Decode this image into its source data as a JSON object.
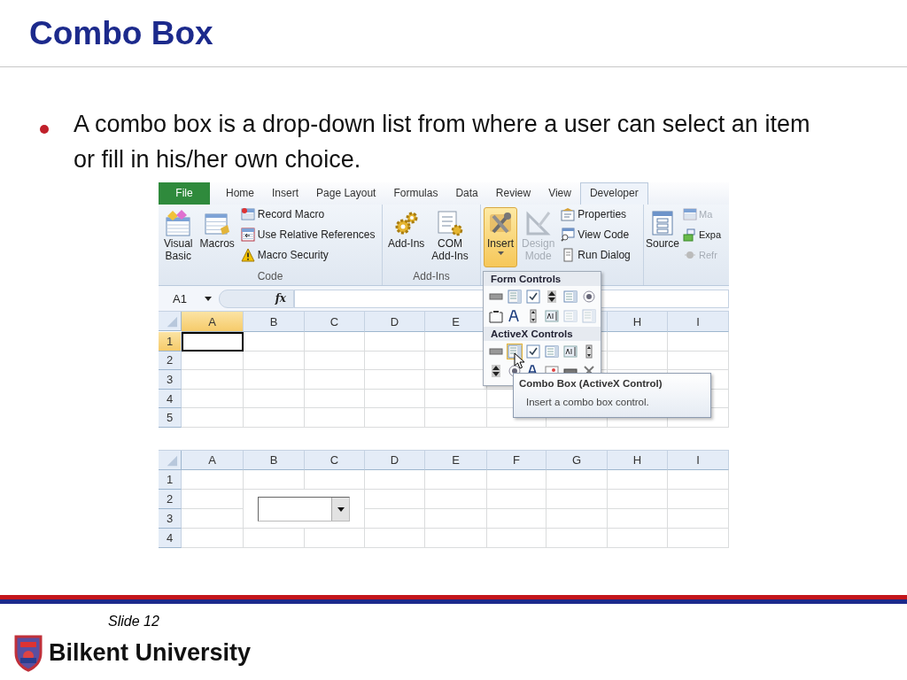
{
  "slide": {
    "title": "Combo Box",
    "bullets": [
      "A combo box is a drop-down list from where a user can select an item or fill in his/her own choice."
    ]
  },
  "ribbon": {
    "tabs": [
      {
        "label": "File",
        "kind": "file",
        "selected": false
      },
      {
        "label": "Home",
        "kind": "tab",
        "selected": false
      },
      {
        "label": "Insert",
        "kind": "tab",
        "selected": false
      },
      {
        "label": "Page Layout",
        "kind": "tab",
        "selected": false
      },
      {
        "label": "Formulas",
        "kind": "tab",
        "selected": false
      },
      {
        "label": "Data",
        "kind": "tab",
        "selected": false
      },
      {
        "label": "Review",
        "kind": "tab",
        "selected": false
      },
      {
        "label": "View",
        "kind": "tab",
        "selected": false
      },
      {
        "label": "Developer",
        "kind": "tab",
        "selected": true
      }
    ],
    "groups": [
      {
        "label": "Code",
        "large": [
          {
            "label": "Visual\nBasic",
            "selected": false,
            "disabled": false
          },
          {
            "label": "Macros",
            "selected": false,
            "disabled": false
          }
        ],
        "small": [
          {
            "label": "Record Macro",
            "disabled": false
          },
          {
            "label": "Use Relative References",
            "disabled": false
          },
          {
            "label": "Macro Security",
            "disabled": false
          }
        ]
      },
      {
        "label": "Add-Ins",
        "large": [
          {
            "label": "Add-Ins",
            "selected": false,
            "disabled": false
          },
          {
            "label": "COM\nAdd-Ins",
            "selected": false,
            "disabled": false
          }
        ]
      },
      {
        "large": [
          {
            "label": "Insert",
            "selected": true,
            "disabled": false,
            "dropdown": true
          },
          {
            "label": "Design\nMode",
            "selected": false,
            "disabled": true
          }
        ],
        "small": [
          {
            "label": "Properties",
            "disabled": false
          },
          {
            "label": "View Code",
            "disabled": false
          },
          {
            "label": "Run Dialog",
            "disabled": false
          }
        ]
      },
      {
        "large": [
          {
            "label": "Source",
            "selected": false,
            "disabled": false
          }
        ],
        "small": [
          {
            "label": "Ma",
            "disabled": true
          },
          {
            "label": "Expa",
            "disabled": false
          },
          {
            "label": "Refr",
            "disabled": true
          }
        ]
      }
    ]
  },
  "formula_bar": {
    "name_box": "A1",
    "function_label": "fx"
  },
  "sheets": [
    {
      "columns": [
        {
          "label": "A",
          "selected": true
        },
        {
          "label": "B",
          "selected": false
        },
        {
          "label": "C",
          "selected": false
        },
        {
          "label": "D",
          "selected": false
        },
        {
          "label": "E",
          "selected": false
        },
        {
          "label": "H",
          "selected": false
        },
        {
          "label": "I",
          "selected": false
        }
      ],
      "rows": [
        {
          "label": "1",
          "selected": true
        },
        {
          "label": "2",
          "selected": false
        },
        {
          "label": "3",
          "selected": false
        },
        {
          "label": "4",
          "selected": false
        },
        {
          "label": "5",
          "selected": false
        }
      ]
    },
    {
      "columns": [
        {
          "label": "A",
          "selected": false
        },
        {
          "label": "B",
          "selected": false
        },
        {
          "label": "C",
          "selected": false
        },
        {
          "label": "D",
          "selected": false
        },
        {
          "label": "E",
          "selected": false
        },
        {
          "label": "F",
          "selected": false
        },
        {
          "label": "G",
          "selected": false
        },
        {
          "label": "H",
          "selected": false
        },
        {
          "label": "I",
          "selected": false
        }
      ],
      "rows": [
        {
          "label": "1",
          "selected": false
        },
        {
          "label": "2",
          "selected": false
        },
        {
          "label": "3",
          "selected": false
        },
        {
          "label": "4",
          "selected": false
        }
      ],
      "controls": [
        {
          "kind": "combo_box"
        }
      ]
    }
  ],
  "gallery": {
    "sections": [
      {
        "label": "Form Controls",
        "items": [
          {
            "kind": "button",
            "selected": false,
            "disabled": false
          },
          {
            "kind": "combo",
            "selected": false,
            "disabled": false
          },
          {
            "kind": "check",
            "selected": false,
            "disabled": false
          },
          {
            "kind": "spin",
            "selected": false,
            "disabled": false
          },
          {
            "kind": "list",
            "selected": false,
            "disabled": false
          },
          {
            "kind": "option",
            "selected": false,
            "disabled": false
          },
          {
            "kind": "group",
            "selected": false,
            "disabled": false
          },
          {
            "kind": "label",
            "selected": false,
            "disabled": false
          },
          {
            "kind": "scroll",
            "selected": false,
            "disabled": false
          },
          {
            "kind": "text",
            "selected": false,
            "disabled": false
          },
          {
            "kind": "list",
            "selected": false,
            "disabled": true
          },
          {
            "kind": "combo",
            "selected": false,
            "disabled": true
          }
        ]
      },
      {
        "label": "ActiveX Controls",
        "items": [
          {
            "kind": "button",
            "selected": false,
            "disabled": false
          },
          {
            "kind": "combo",
            "selected": true,
            "disabled": false
          },
          {
            "kind": "check",
            "selected": false,
            "disabled": false
          },
          {
            "kind": "list",
            "selected": false,
            "disabled": false
          },
          {
            "kind": "text",
            "selected": false,
            "disabled": false
          },
          {
            "kind": "scroll",
            "selected": false,
            "disabled": false
          },
          {
            "kind": "spin",
            "selected": false,
            "disabled": false
          },
          {
            "kind": "option",
            "selected": false,
            "disabled": false
          },
          {
            "kind": "label",
            "selected": false,
            "disabled": false
          },
          {
            "kind": "image",
            "selected": false,
            "disabled": false
          },
          {
            "kind": "toggle",
            "selected": false,
            "disabled": false
          },
          {
            "kind": "more",
            "selected": false,
            "disabled": false
          }
        ]
      }
    ]
  },
  "tooltip": {
    "title": "Combo Box (ActiveX Control)",
    "description": "Insert a combo box control."
  },
  "footer": {
    "slide_label": "Slide 12",
    "logo_text": "Bilkent University"
  }
}
